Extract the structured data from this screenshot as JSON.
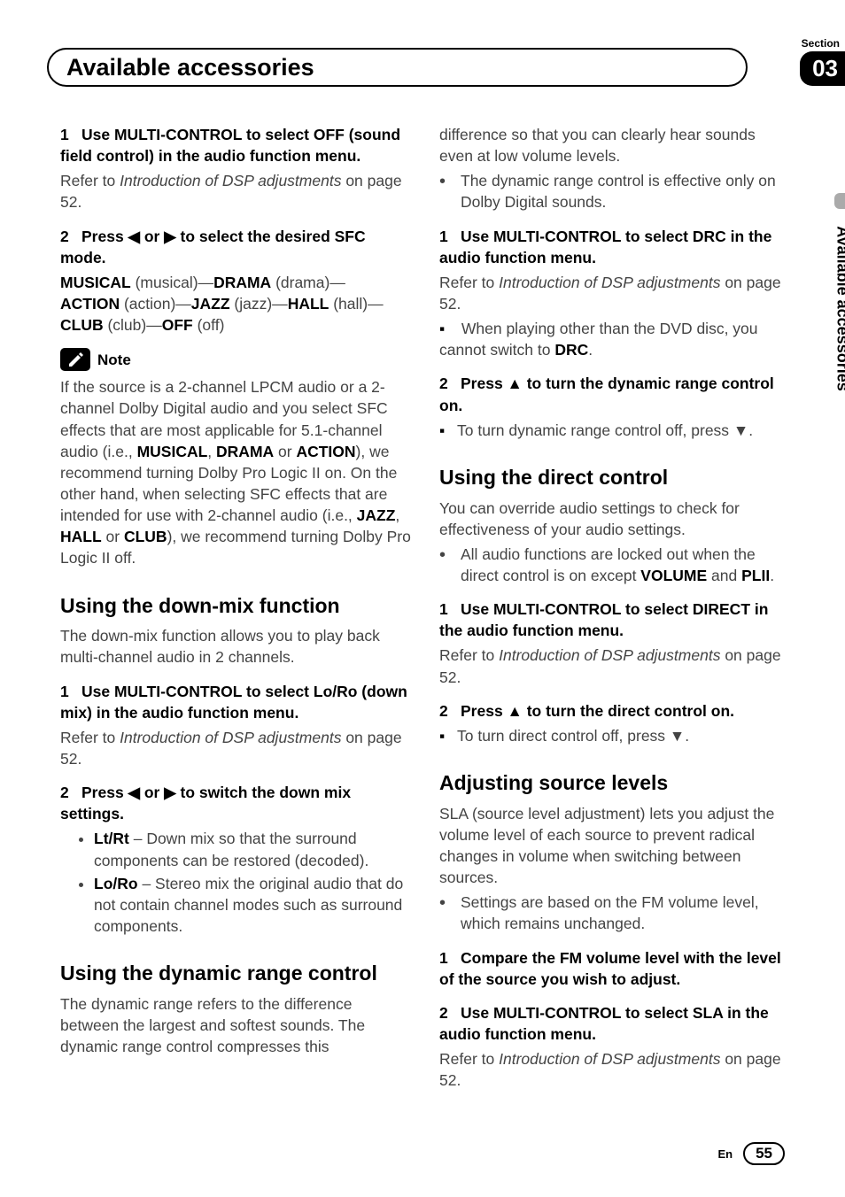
{
  "header": {
    "title": "Available accessories",
    "section_label": "Section",
    "section_number": "03"
  },
  "side_tab": "Available accessories",
  "left": {
    "s1": {
      "num": "1",
      "head_a": "Use MULTI-CONTROL to select OFF (sound field control) in the audio function menu.",
      "body_a": "Refer to ",
      "body_it": "Introduction of DSP adjustments",
      "body_b": " on page 52."
    },
    "s2": {
      "num": "2",
      "head": "Press ◀ or ▶ to select the desired SFC mode.",
      "opt_musical": "MUSICAL",
      "opt_musical_p": " (musical)—",
      "opt_drama": "DRAMA",
      "opt_drama_p": " (drama)—",
      "opt_action": "ACTION",
      "opt_action_p": " (action)—",
      "opt_jazz": "JAZZ",
      "opt_jazz_p": " (jazz)—",
      "opt_hall": "HALL",
      "opt_hall_p": " (hall)—",
      "opt_club": "CLUB",
      "opt_club_p": " (club)—",
      "opt_off": "OFF",
      "opt_off_p": " (off)"
    },
    "note_label": "Note",
    "note_a": "If the source is a 2-channel LPCM audio or a 2-channel Dolby Digital audio and you select SFC effects that are most applicable for 5.1-channel audio (i.e., ",
    "note_b1": "MUSICAL",
    "note_c1": ", ",
    "note_b2": "DRAMA",
    "note_c2": " or ",
    "note_b3": "ACTION",
    "note_c3": "), we recommend turning Dolby Pro Logic II on. On the other hand, when selecting SFC effects that are intended for use with 2-channel audio (i.e., ",
    "note_b4": "JAZZ",
    "note_c4": ", ",
    "note_b5": "HALL",
    "note_c5": " or ",
    "note_b6": "CLUB",
    "note_c6": "), we recommend turning Dolby Pro Logic II off.",
    "h_downmix": "Using the down-mix function",
    "downmix_intro": "The down-mix function allows you to play back multi-channel audio in 2 channels.",
    "dm1": {
      "num": "1",
      "head": "Use MULTI-CONTROL to select Lo/Ro (down mix) in the audio function menu.",
      "body_a": "Refer to ",
      "body_it": "Introduction of DSP adjustments",
      "body_b": " on page 52."
    },
    "dm2": {
      "num": "2",
      "head": "Press ◀ or ▶ to switch the down mix settings.",
      "li1_b": "Lt/Rt",
      "li1_t": " – Down mix so that the surround components can be restored (decoded).",
      "li2_b": "Lo/Ro",
      "li2_t": " – Stereo mix the original audio that do not contain channel modes such as surround components."
    },
    "h_drc": "Using the dynamic range control",
    "drc_intro": "The dynamic range refers to the difference between the largest and softest sounds. The dynamic range control compresses this"
  },
  "right": {
    "cont": "difference so that you can clearly hear sounds even at low volume levels.",
    "cont_li": "The dynamic range control is effective only on Dolby Digital sounds.",
    "drc1": {
      "num": "1",
      "head": "Use MULTI-CONTROL to select DRC in the audio function menu.",
      "body_a": "Refer to ",
      "body_it": "Introduction of DSP adjustments",
      "body_b": " on page 52.",
      "sq_a": "When playing other than the DVD disc, you cannot switch to ",
      "sq_b": "DRC",
      "sq_c": "."
    },
    "drc2": {
      "num": "2",
      "head": "Press ▲ to turn the dynamic range control on.",
      "sq": "To turn dynamic range control off, press ▼."
    },
    "h_direct": "Using the direct control",
    "direct_intro": "You can override audio settings to check for effectiveness of your audio settings.",
    "direct_li_a": "All audio functions are locked out when the direct control is on except ",
    "direct_li_b1": "VOLUME",
    "direct_li_c1": " and ",
    "direct_li_b2": "PLII",
    "direct_li_c2": ".",
    "dir1": {
      "num": "1",
      "head": "Use MULTI-CONTROL to select DIRECT in the audio function menu.",
      "body_a": "Refer to ",
      "body_it": "Introduction of DSP adjustments",
      "body_b": " on page 52."
    },
    "dir2": {
      "num": "2",
      "head": "Press ▲ to turn the direct control on.",
      "sq": "To turn direct control off, press ▼."
    },
    "h_sla": "Adjusting source levels",
    "sla_intro": "SLA (source level adjustment) lets you adjust the volume level of each source to prevent radical changes in volume when switching between sources.",
    "sla_li": "Settings are based on the FM volume level, which remains unchanged.",
    "sla1": {
      "num": "1",
      "head": "Compare the FM volume level with the level of the source you wish to adjust."
    },
    "sla2": {
      "num": "2",
      "head": "Use MULTI-CONTROL to select SLA in the audio function menu.",
      "body_a": "Refer to ",
      "body_it": "Introduction of DSP adjustments",
      "body_b": " on page 52."
    }
  },
  "footer": {
    "lang": "En",
    "page": "55"
  }
}
